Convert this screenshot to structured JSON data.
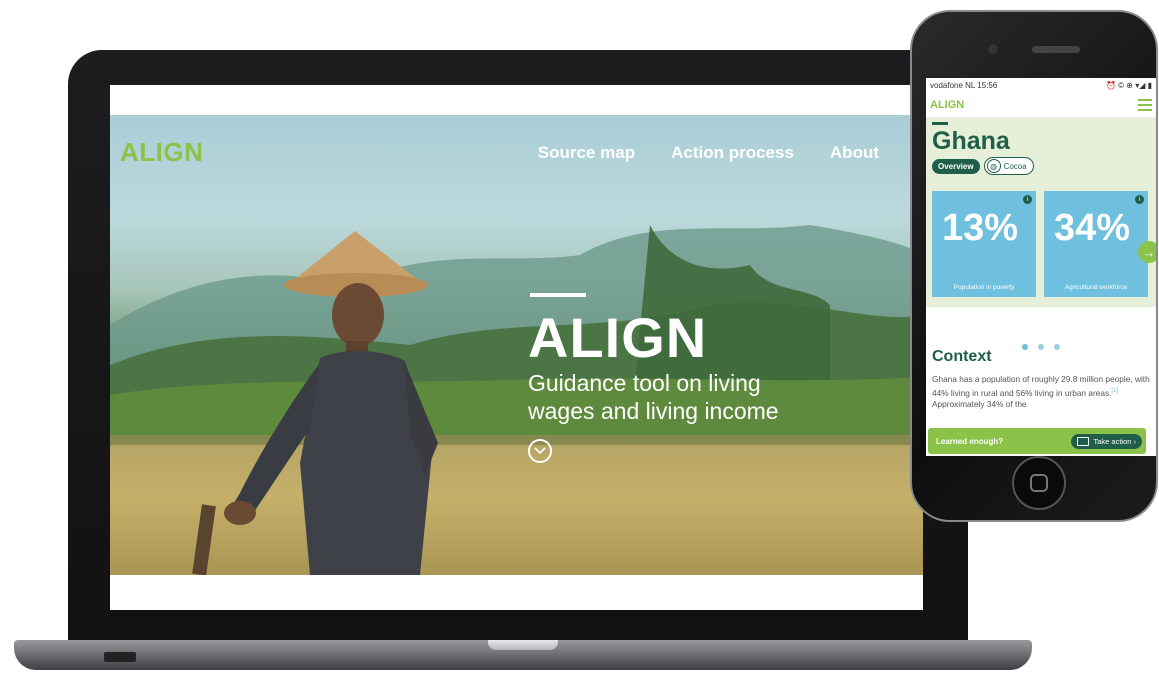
{
  "laptop": {
    "logo": "ALIGN",
    "nav": [
      "Source map",
      "Action process",
      "About"
    ],
    "hero": {
      "title": "ALIGN",
      "subtitle": "Guidance tool on living wages and living income",
      "scroll_icon": "chevron-down-circle-icon"
    }
  },
  "phone": {
    "status": {
      "carrier_time": "vodafone NL 15:56",
      "icons": "⏰ © ⊕ ▾◢ ▮"
    },
    "header": {
      "logo": "ALIGN",
      "menu_icon": "hamburger-icon"
    },
    "country": "Ghana",
    "tabs": {
      "overview": "Overview",
      "cocoa": "Cocoa"
    },
    "stats": [
      {
        "value": "13%",
        "label": "Population in poverty"
      },
      {
        "value": "34%",
        "label": "Agricultural workforce"
      }
    ],
    "context": {
      "title": "Context",
      "text_a": "Ghana has a population of roughly 29.8 million people, with 44% living in rural and 56% living in urban areas.",
      "ref": "[1]",
      "text_b": " Approximately 34% of the"
    },
    "cta": {
      "text": "Learned enough?",
      "button": "Take action ›"
    }
  },
  "colors": {
    "brand_green": "#8bc34a",
    "dark_green": "#1f5f4a",
    "stat_blue": "#6ec0de",
    "light_green_bg": "#e6efd8"
  }
}
